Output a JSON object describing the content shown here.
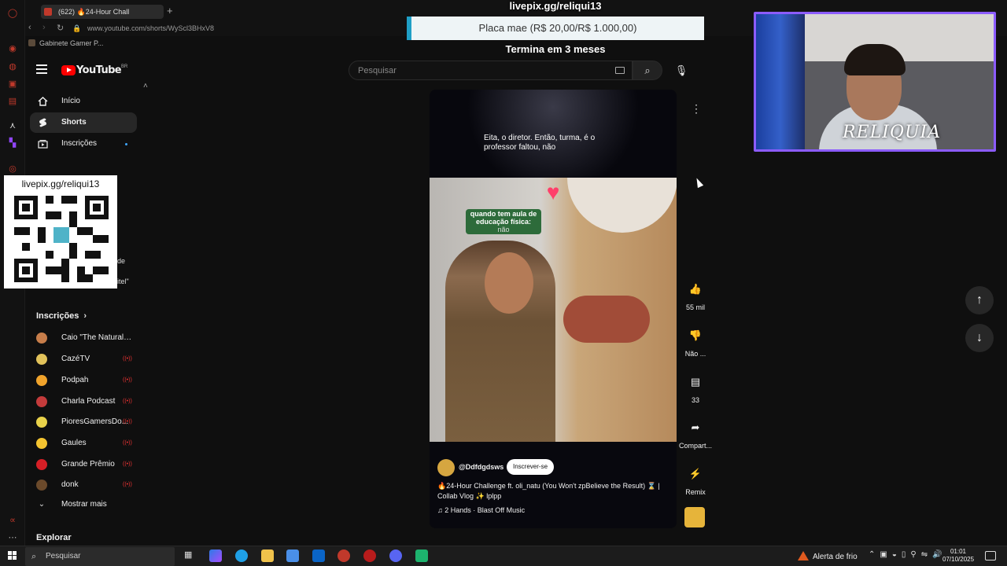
{
  "browser": {
    "tab_title": "(622) 🔥24-Hour Chall",
    "url": "www.youtube.com/shorts/WyScl3BHxV8",
    "bookmark": "Gabinete Gamer P..."
  },
  "youtube": {
    "logo_text": "YouTube",
    "country": "BR",
    "search_placeholder": "Pesquisar"
  },
  "livepix": {
    "title": "livepix.gg/reliqui13",
    "goal": "Placa mae (R$ 20,00/R$ 1.000,00)",
    "ends": "Termina em 3 meses",
    "qr_label": "livepix.gg/reliqui13"
  },
  "sidebar": {
    "items": [
      {
        "label": "Início"
      },
      {
        "label": "Shorts"
      },
      {
        "label": "Inscrições"
      }
    ],
    "peek_1": "de",
    "peek_2": "itel\"",
    "subs_title": "Inscrições",
    "subscriptions": [
      {
        "name": "Caio \"The Natural\" ...",
        "color": "#c77d4a",
        "live": false
      },
      {
        "name": "CazéTV",
        "color": "#e1c25a",
        "live": true
      },
      {
        "name": "Podpah",
        "color": "#f0a32b",
        "live": true
      },
      {
        "name": "Charla Podcast",
        "color": "#c43b3b",
        "live": true
      },
      {
        "name": "PioresGamersDo...",
        "color": "#e9d24a",
        "live": true
      },
      {
        "name": "Gaules",
        "color": "#f4c430",
        "live": true
      },
      {
        "name": "Grande Prêmio",
        "color": "#d61f26",
        "live": true
      },
      {
        "name": "donk",
        "color": "#6b4a2b",
        "live": true
      }
    ],
    "show_more": "Mostrar mais",
    "explore": "Explorar"
  },
  "short": {
    "caption": "Eita, o diretor. Então, turma, é o professor faltou, não",
    "meme_text": "quando tem aula de educação física:",
    "meme_sub": "não",
    "channel": "@Ddfdgdsws",
    "subscribe": "Inscrever-se",
    "title": "🔥24-Hour Challenge ft. oli_natu (You Won't zpBelieve the Result) ⌛ | Collab Vlog ✨ lplpp",
    "music": "2 Hands · Blast Off Music",
    "like_count": "55 mil",
    "dislike_label": "Não ...",
    "comment_count": "33",
    "share_label": "Compart...",
    "remix_label": "Remix"
  },
  "webcam": {
    "brand": "RELIQUIA"
  },
  "taskbar": {
    "search": "Pesquisar",
    "alert": "Alerta de frio",
    "time": "01:01",
    "date": "07/10/2025"
  }
}
